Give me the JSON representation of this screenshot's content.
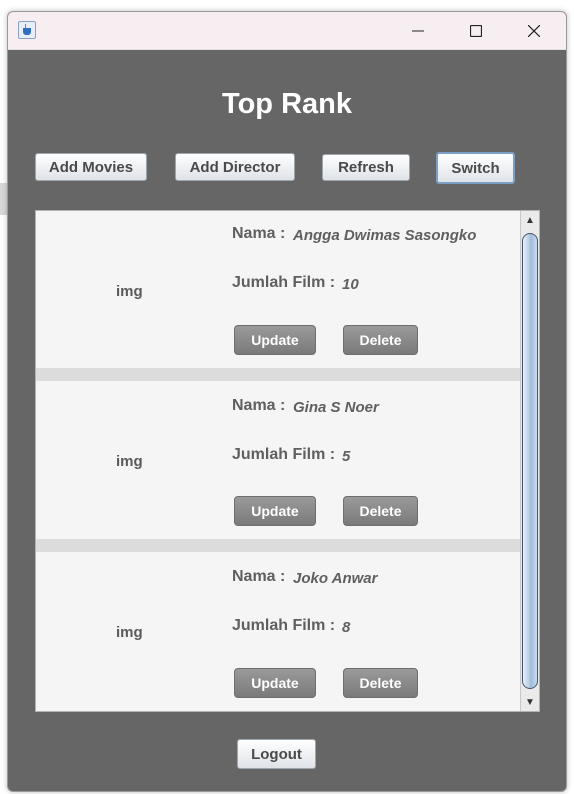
{
  "window": {
    "icon": "java-cup-icon",
    "controls": {
      "minimize": "minimize-icon",
      "maximize": "maximize-icon",
      "close": "close-icon"
    }
  },
  "page": {
    "title": "Top Rank",
    "buttons": {
      "add_movies": "Add Movies",
      "add_director": "Add Director",
      "refresh": "Refresh",
      "switch": "Switch",
      "logout": "Logout"
    }
  },
  "directors": [
    {
      "img": "img",
      "nama_label": "Nama :",
      "nama": "Angga Dwimas Sasongko",
      "film_label": "Jumlah Film :",
      "jumlah_film": "10",
      "update": "Update",
      "delete": "Delete"
    },
    {
      "img": "img",
      "nama_label": "Nama :",
      "nama": "Gina S Noer",
      "film_label": "Jumlah Film :",
      "jumlah_film": "5",
      "update": "Update",
      "delete": "Delete"
    },
    {
      "img": "img",
      "nama_label": "Nama :",
      "nama": "Joko Anwar",
      "film_label": "Jumlah Film :",
      "jumlah_film": "8",
      "update": "Update",
      "delete": "Delete"
    }
  ],
  "colors": {
    "window_bg": "#666666",
    "card_bg": "#f5f5f5",
    "separator": "#dcdcdc",
    "card_button": "#888888"
  }
}
